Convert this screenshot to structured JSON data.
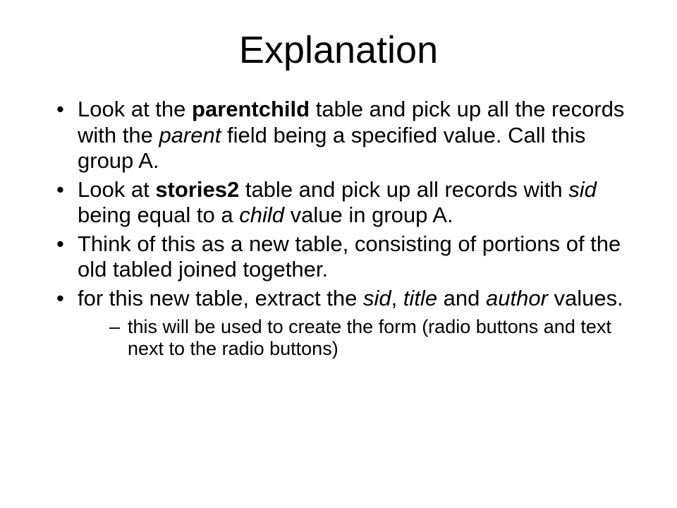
{
  "title": "Explanation",
  "bullets": {
    "b1_pre": "Look at the ",
    "b1_bold": "parentchild",
    "b1_mid": " table and pick up all the records with the ",
    "b1_ital": "parent",
    "b1_post": " field being a specified value. Call this group A.",
    "b2_pre": "Look at ",
    "b2_bold": "stories2",
    "b2_mid": " table and pick up all records with ",
    "b2_ital1": "sid",
    "b2_mid2": " being equal to a ",
    "b2_ital2": "child",
    "b2_post": " value in group A.",
    "b3": "Think of this as a new table, consisting of portions of the old tabled joined together.",
    "b4_pre": "for this new table, extract the ",
    "b4_i1": "sid",
    "b4_c1": ", ",
    "b4_i2": "title",
    "b4_c2": " and ",
    "b4_i3": "author",
    "b4_post": " values.",
    "sub1": "this will be used to create the form (radio buttons and text next to the radio buttons)"
  }
}
